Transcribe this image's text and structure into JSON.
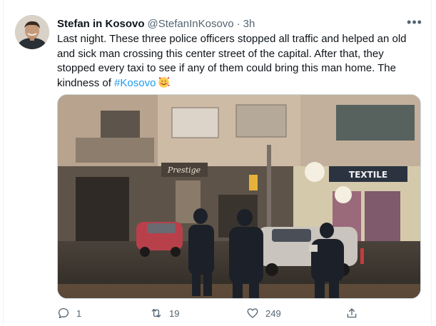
{
  "tweet": {
    "display_name": "Stefan in Kosovo",
    "handle": "@StefanInKosovo",
    "separator": "·",
    "time": "3h",
    "more_label": "•••",
    "text_before": "Last night. These three police officers stopped all traffic and helped an old and sick man crossing this center street of the capital. After that, they stopped every taxi to see if any of them could bring this man home. The kindness of ",
    "hashtag": "#Kosovo",
    "emoji_icon": "smiling-face-with-hearts-icon"
  },
  "media": {
    "description_icon": "photo-police-officers-street-night",
    "signs": [
      "Prestige",
      "TEXTILE"
    ]
  },
  "actions": {
    "reply_count": "1",
    "retweet_count": "19",
    "like_count": "249"
  },
  "colors": {
    "accent": "#1d9bf0",
    "secondary_text": "#536471",
    "primary_text": "#0f1419"
  }
}
